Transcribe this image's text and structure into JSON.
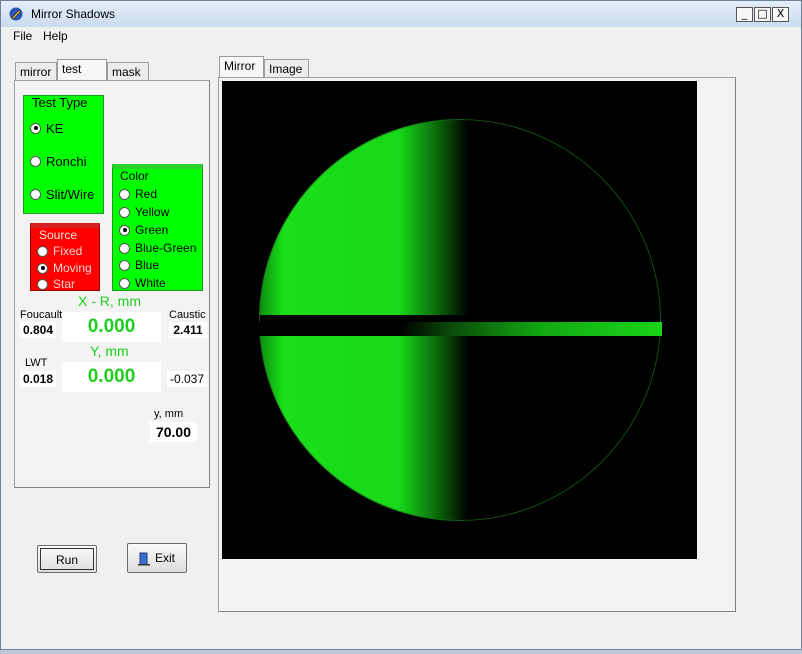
{
  "window": {
    "title": "Mirror Shadows",
    "controls": {
      "minimize": "_",
      "maximize": "□",
      "close": "X"
    }
  },
  "menu": {
    "file": "File",
    "help": "Help"
  },
  "left_tabs": [
    {
      "label": "mirror"
    },
    {
      "label": "test"
    },
    {
      "label": "mask"
    }
  ],
  "test_type": {
    "title": "Test Type",
    "options": [
      "KE",
      "Ronchi",
      "Slit/Wire"
    ],
    "selected": "KE"
  },
  "color": {
    "title": "Color",
    "options": [
      "Red",
      "Yellow",
      "Green",
      "Blue-Green",
      "Blue",
      "White"
    ],
    "selected": "Green"
  },
  "source": {
    "title": "Source",
    "options": [
      "Fixed",
      "Moving",
      "Star"
    ],
    "selected": "Moving"
  },
  "readouts": {
    "x_label": "X - R, mm",
    "x_value": "0.000",
    "foucault_label": "Foucault",
    "foucault_value": "0.804",
    "caustic_label": "Caustic",
    "caustic_value": "2.411",
    "y_label": "Y, mm",
    "y_value": "0.000",
    "lwt_label": "LWT",
    "lwt_value": "0.018",
    "right_value": "-0.037",
    "ymm_label": "y, mm",
    "ymm_value": "70.00"
  },
  "buttons": {
    "run": "Run",
    "exit": "Exit"
  },
  "right_tabs": [
    {
      "label": "Mirror"
    },
    {
      "label": "Image"
    }
  ],
  "colors": {
    "green_panel": "#00ff00",
    "source_panel": "#ff0000",
    "readout_green": "#1ecf1e"
  },
  "icons": {
    "app": "app-pen-icon",
    "exit": "door-exit-icon"
  }
}
